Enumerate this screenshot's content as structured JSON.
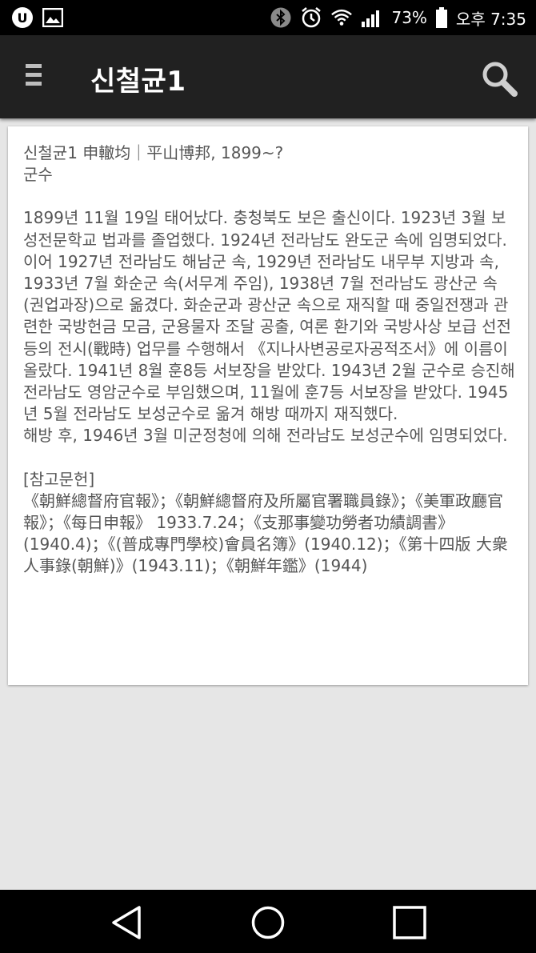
{
  "status_bar": {
    "battery": "73%",
    "time": "오후 7:35",
    "icons": [
      "lg-uplus-icon",
      "gallery-icon",
      "bluetooth-icon",
      "alarm-icon",
      "wifi-icon",
      "signal-icon",
      "battery-icon"
    ]
  },
  "app_bar": {
    "title": "신철균1",
    "menu_icon": "hamburger-icon",
    "search_icon": "search-icon"
  },
  "article": {
    "heading": "신철균1 申轍均｜平山博邦, 1899~?",
    "position": "군수",
    "body": [
      "1899년 11월 19일 태어났다. 충청북도 보은 출신이다. 1923년 3월 보성전문학교 법과를 졸업했다. 1924년 전라남도 완도군 속에 임명되었다. 이어 1927년 전라남도 해남군 속, 1929년 전라남도 내무부 지방과 속, 1933년 7월 화순군 속(서무계 주임), 1938년 7월 전라남도 광산군 속(권업과장)으로 옮겼다. 화순군과 광산군 속으로 재직할 때 중일전쟁과 관련한 국방헌금 모금, 군용물자 조달 공출, 여론 환기와 국방사상 보급 선전 등의 전시(戰時) 업무를 수행해서 《지나사변공로자공적조서》에 이름이 올랐다. 1941년 8월 훈8등 서보장을 받았다. 1943년 2월 군수로 승진해 전라남도 영암군수로 부임했으며, 11월에 훈7등 서보장을 받았다. 1945년 5월 전라남도 보성군수로 옮겨 해방 때까지 재직했다.",
      "해방 후, 1946년 3월 미군정청에 의해 전라남도 보성군수에 임명되었다."
    ],
    "references_title": "[참고문헌]",
    "references": "《朝鮮總督府官報》；《朝鮮總督府及所屬官署職員錄》；《美軍政廳官報》；《每日申報》 1933.7.24；《支那事變功勞者功績調書》(1940.4)；《(普成專門學校)會員名簿》(1940.12)；《第十四版 大衆人事錄(朝鮮)》(1943.11)；《朝鮮年鑑》(1944)"
  },
  "nav_bar": {
    "icons": [
      "back-icon",
      "home-icon",
      "recents-icon"
    ]
  }
}
